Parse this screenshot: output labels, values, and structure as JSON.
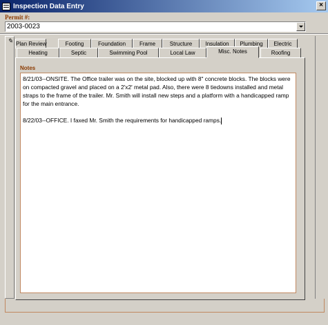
{
  "window": {
    "title": "Inspection Data Entry",
    "close_label": "×"
  },
  "permit": {
    "label": "Permit #:",
    "value": "2003-0023"
  },
  "tabs_row1": [
    "Plan Review",
    "Footing",
    "Foundation",
    "Frame",
    "Structure",
    "Insulation",
    "Plumbing",
    "Electric"
  ],
  "tabs_row2": [
    "Heating",
    "Septic",
    "Swimming Pool",
    "Local Law",
    "Misc. Notes",
    "Roofing"
  ],
  "active_tab": "Misc. Notes",
  "notes": {
    "label": "Notes",
    "paragraphs": [
      "8/21/03--ONSITE.  The Office trailer was on the site, blocked up with 8\" concrete blocks.  The blocks were on compacted gravel and placed on a 2'x2' metal pad.  Also, there were 8 tiedowns installed and metal straps to the frame of the trailer.  Mr. Smith will install new steps and a platform with a handicapped ramp for the main entrance.",
      "8/22/03--OFFICE.  I faxed Mr. Smith the requirements for handicapped ramps."
    ]
  },
  "colors": {
    "title_gradient_start": "#0a246a",
    "label_color": "#8b3a00",
    "form_bg": "#d4d0c8"
  }
}
